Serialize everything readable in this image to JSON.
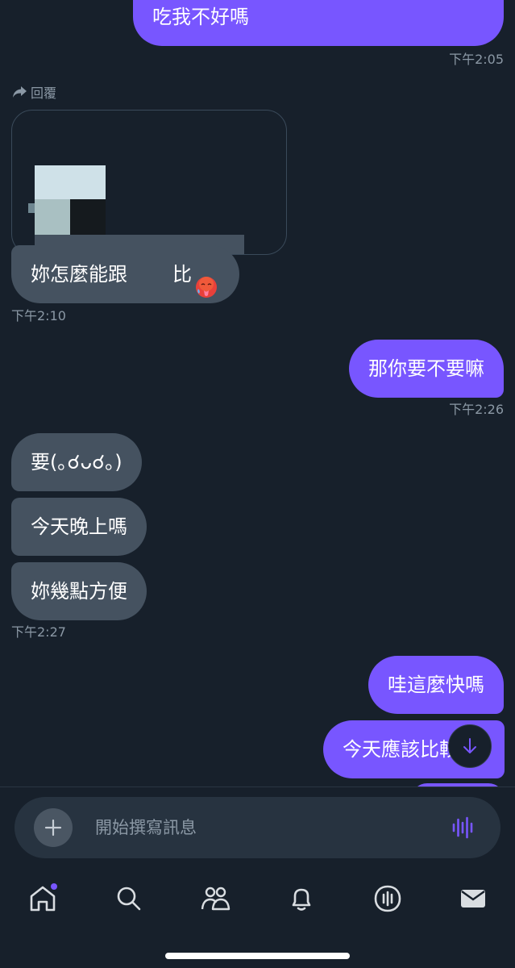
{
  "messages": {
    "m1": "吃我不好嗎",
    "t1": "下午2:05",
    "reply_label": "回覆",
    "m2_text": "妳怎麼能跟",
    "m2_suffix": "比",
    "t2": "下午2:10",
    "m3": "那你要不要嘛",
    "t3": "下午2:26",
    "m4": "要(｡☌ᴗ☌｡)",
    "m5": "今天晚上嗎",
    "m6": "妳幾點方便",
    "t4": "下午2:27",
    "m7": "哇這麼快嗎",
    "m8": "今天應該比較"
  },
  "composer": {
    "placeholder": "開始撰寫訊息"
  },
  "nav": {
    "items": [
      "home-icon",
      "search-icon",
      "communities-icon",
      "notifications-icon",
      "spaces-icon",
      "messages-icon"
    ]
  },
  "colors": {
    "accent": "#7856ff",
    "background": "#17202b",
    "incoming_bubble": "#455260",
    "muted_text": "#8b98a5"
  }
}
